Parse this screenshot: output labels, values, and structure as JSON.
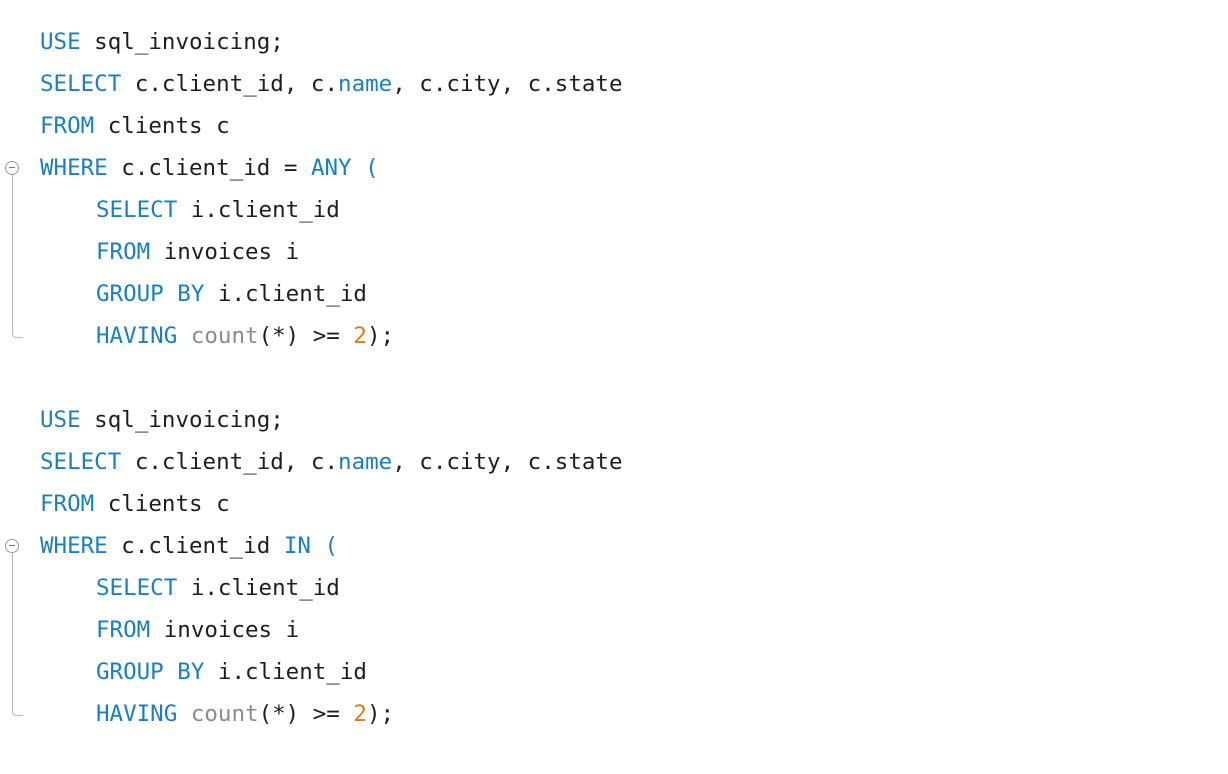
{
  "editor": {
    "blocks": [
      {
        "lines": [
          [
            {
              "t": "kw",
              "v": "USE"
            },
            {
              "t": "plain",
              "v": " sql_invoicing;"
            }
          ],
          [
            {
              "t": "kw",
              "v": "SELECT"
            },
            {
              "t": "plain",
              "v": " c.client_id, c."
            },
            {
              "t": "kw",
              "v": "name"
            },
            {
              "t": "plain",
              "v": ", c.city, c.state"
            }
          ],
          [
            {
              "t": "kw",
              "v": "FROM"
            },
            {
              "t": "plain",
              "v": " clients c"
            }
          ],
          [
            {
              "t": "kw",
              "v": "WHERE"
            },
            {
              "t": "plain",
              "v": " c.client_id = "
            },
            {
              "t": "kw",
              "v": "ANY"
            },
            {
              "t": "plain",
              "v": " "
            },
            {
              "t": "kw",
              "v": "("
            }
          ],
          [
            {
              "t": "indent"
            },
            {
              "t": "kw",
              "v": "SELECT"
            },
            {
              "t": "plain",
              "v": " i.client_id"
            }
          ],
          [
            {
              "t": "indent"
            },
            {
              "t": "kw",
              "v": "FROM"
            },
            {
              "t": "plain",
              "v": " invoices i"
            }
          ],
          [
            {
              "t": "indent"
            },
            {
              "t": "kw",
              "v": "GROUP BY"
            },
            {
              "t": "plain",
              "v": " i.client_id"
            }
          ],
          [
            {
              "t": "indent"
            },
            {
              "t": "kw",
              "v": "HAVING"
            },
            {
              "t": "plain",
              "v": " "
            },
            {
              "t": "fn",
              "v": "count"
            },
            {
              "t": "plain",
              "v": "(*) >= "
            },
            {
              "t": "num",
              "v": "2"
            },
            {
              "t": "plain",
              "v": ");"
            }
          ]
        ]
      },
      {
        "lines": [
          [
            {
              "t": "kw",
              "v": "USE"
            },
            {
              "t": "plain",
              "v": " sql_invoicing;"
            }
          ],
          [
            {
              "t": "kw",
              "v": "SELECT"
            },
            {
              "t": "plain",
              "v": " c.client_id, c."
            },
            {
              "t": "kw",
              "v": "name"
            },
            {
              "t": "plain",
              "v": ", c.city, c.state"
            }
          ],
          [
            {
              "t": "kw",
              "v": "FROM"
            },
            {
              "t": "plain",
              "v": " clients c"
            }
          ],
          [
            {
              "t": "kw",
              "v": "WHERE"
            },
            {
              "t": "plain",
              "v": " c.client_id "
            },
            {
              "t": "kw",
              "v": "IN"
            },
            {
              "t": "plain",
              "v": " "
            },
            {
              "t": "kw",
              "v": "("
            }
          ],
          [
            {
              "t": "indent"
            },
            {
              "t": "kw",
              "v": "SELECT"
            },
            {
              "t": "plain",
              "v": " i.client_id"
            }
          ],
          [
            {
              "t": "indent"
            },
            {
              "t": "kw",
              "v": "FROM"
            },
            {
              "t": "plain",
              "v": " invoices i"
            }
          ],
          [
            {
              "t": "indent"
            },
            {
              "t": "kw",
              "v": "GROUP BY"
            },
            {
              "t": "plain",
              "v": " i.client_id"
            }
          ],
          [
            {
              "t": "indent"
            },
            {
              "t": "kw",
              "v": "HAVING"
            },
            {
              "t": "plain",
              "v": " "
            },
            {
              "t": "fn",
              "v": "count"
            },
            {
              "t": "plain",
              "v": "(*) >= "
            },
            {
              "t": "num",
              "v": "2"
            },
            {
              "t": "plain",
              "v": ");"
            }
          ]
        ]
      }
    ],
    "icons": {
      "fold": "collapse-minus-circle-icon"
    },
    "colors": {
      "keyword": "#1a7fc1",
      "function": "#8c8c8c",
      "number": "#e07b1a",
      "text": "#1e1e1e",
      "background": "#ffffff"
    }
  }
}
